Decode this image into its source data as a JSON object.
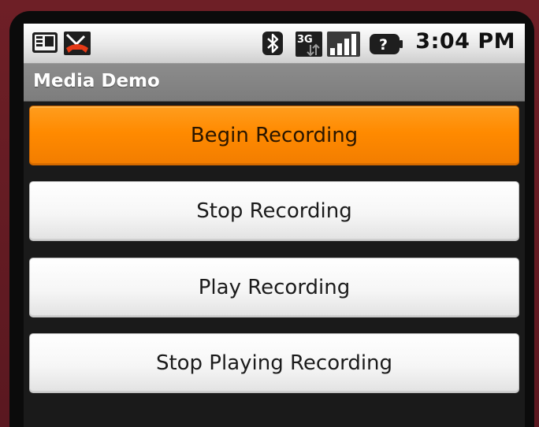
{
  "status_bar": {
    "time": "3:04 PM",
    "icons": [
      "notification-icon",
      "missed-call-icon",
      "bluetooth-icon",
      "3g-data-icon",
      "signal-strength-icon",
      "battery-unknown-icon"
    ],
    "network_label": "3G",
    "battery_label": "?"
  },
  "title_bar": {
    "title": "Media Demo"
  },
  "buttons": [
    {
      "label": "Begin Recording",
      "state": "focused"
    },
    {
      "label": "Stop Recording",
      "state": "normal"
    },
    {
      "label": "Play Recording",
      "state": "normal"
    },
    {
      "label": "Stop Playing Recording",
      "state": "normal"
    }
  ],
  "colors": {
    "focus_orange": "#ff8a00",
    "frame_maroon": "#6e1f26",
    "title_gray": "#8c8c8c",
    "background": "#1a1a1a"
  }
}
